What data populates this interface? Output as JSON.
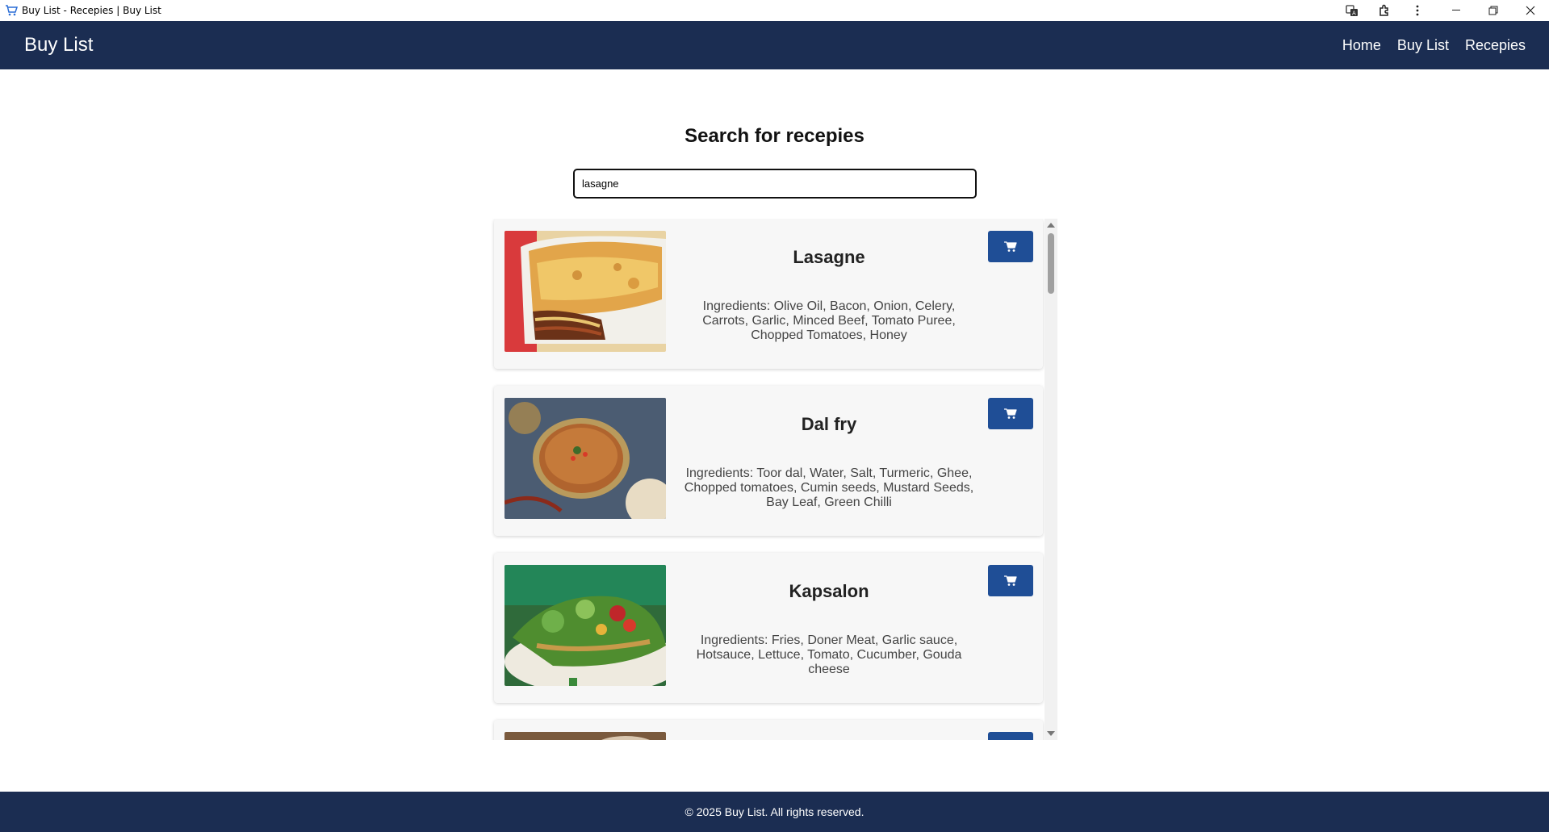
{
  "window": {
    "title": "Buy List - Recepies | Buy List"
  },
  "navbar": {
    "brand": "Buy List",
    "links": [
      "Home",
      "Buy List",
      "Recepies"
    ]
  },
  "main": {
    "title": "Search for recepies",
    "search": {
      "value": "lasagne",
      "placeholder": ""
    },
    "recipes": [
      {
        "name": "Lasagne",
        "ingredients": "Ingredients: Olive Oil, Bacon, Onion, Celery, Carrots, Garlic, Minced Beef, Tomato Puree, Chopped Tomatoes, Honey",
        "image": "lasagne-photo"
      },
      {
        "name": "Dal fry",
        "ingredients": "Ingredients: Toor dal, Water, Salt, Turmeric, Ghee, Chopped tomatoes, Cumin seeds, Mustard Seeds, Bay Leaf, Green Chilli",
        "image": "dal-fry-photo"
      },
      {
        "name": "Kapsalon",
        "ingredients": "Ingredients: Fries, Doner Meat, Garlic sauce, Hotsauce, Lettuce, Tomato, Cucumber, Gouda cheese",
        "image": "kapsalon-photo"
      }
    ]
  },
  "footer": {
    "text": "© 2025 Buy List. All rights reserved."
  },
  "colors": {
    "navbar": "#1b2d52",
    "cart_button": "#1f4e96",
    "card_bg": "#f7f7f7"
  },
  "icons": {
    "cart": "cart-icon",
    "app": "cart-app-icon"
  }
}
